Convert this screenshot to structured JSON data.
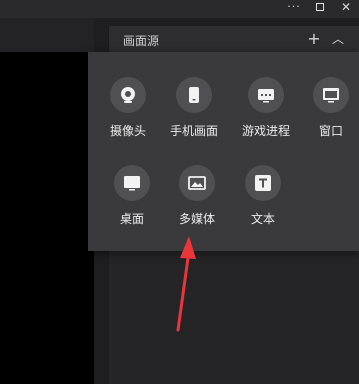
{
  "window": {
    "more_label": "···",
    "close_label": "✕"
  },
  "sources": {
    "title": "画面源",
    "add_label": "+",
    "collapse_label": "︿"
  },
  "menu": {
    "items": [
      {
        "label": "摄像头",
        "icon": "camera-icon"
      },
      {
        "label": "手机画面",
        "icon": "phone-icon"
      },
      {
        "label": "游戏进程",
        "icon": "game-icon"
      },
      {
        "label": "窗口",
        "icon": "window-icon"
      },
      {
        "label": "桌面",
        "icon": "desktop-icon"
      },
      {
        "label": "多媒体",
        "icon": "image-icon"
      },
      {
        "label": "文本",
        "icon": "text-icon"
      }
    ]
  },
  "annotation": {
    "arrow_color": "#e8363b",
    "points_to": "多媒体"
  }
}
